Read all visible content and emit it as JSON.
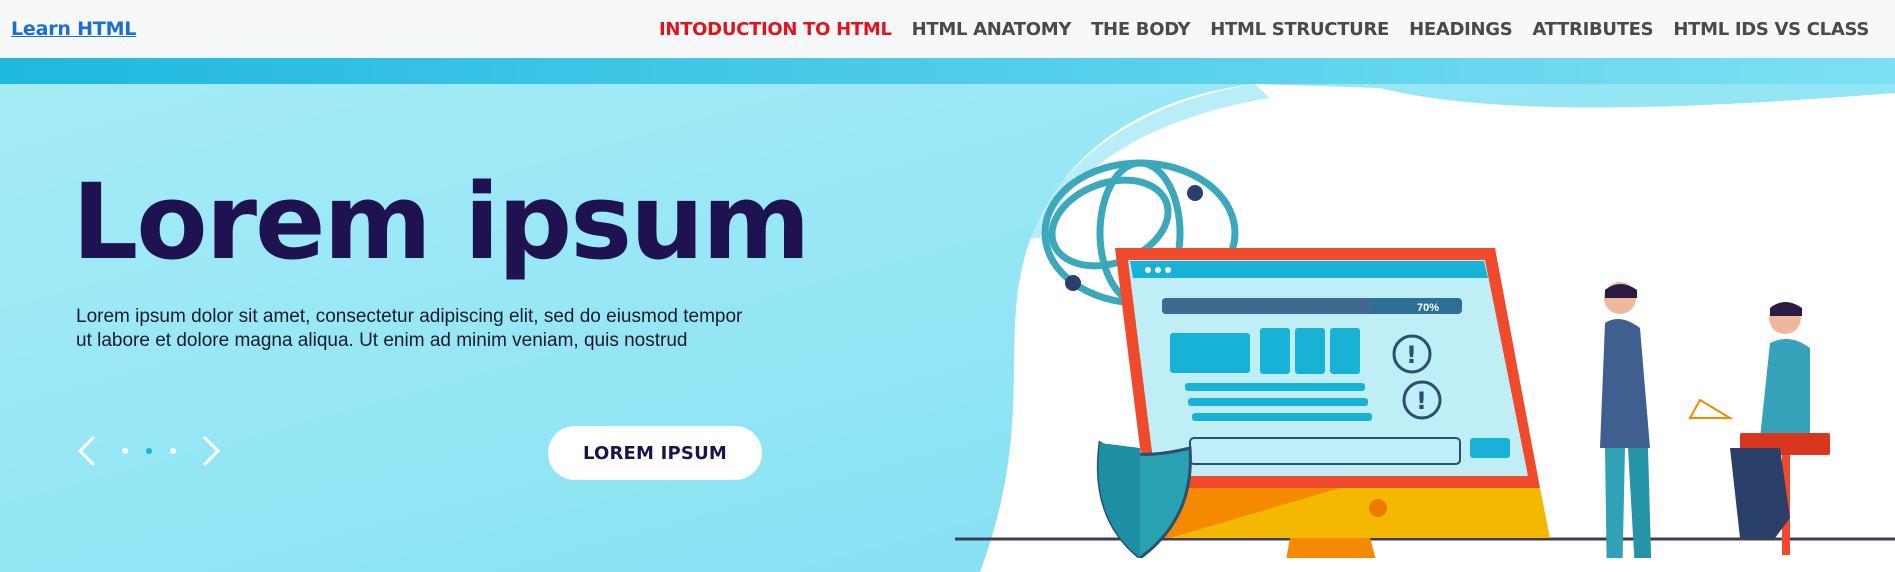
{
  "navbar": {
    "brand": "Learn HTML",
    "links": [
      {
        "label": "INTODUCTION TO HTML",
        "active": true
      },
      {
        "label": "HTML ANATOMY"
      },
      {
        "label": "THE BODY"
      },
      {
        "label": "HTML STRUCTURE"
      },
      {
        "label": "HEADINGS"
      },
      {
        "label": "ATTRIBUTES"
      },
      {
        "label": "HTML IDS VS CLASS"
      }
    ]
  },
  "hero": {
    "title": "Lorem ipsum",
    "text_line1": "Lorem ipsum dolor sit amet, consectetur adipiscing elit, sed do eiusmod tempor",
    "text_line2": "ut labore et dolore magna aliqua. Ut enim ad minim veniam, quis nostrud",
    "cta_label": "LOREM IPSUM",
    "carousel": {
      "slide_count": 3,
      "active_slide": 2
    },
    "illustration": {
      "progress_label": "70%",
      "progress_value": 0.7
    }
  },
  "colors": {
    "active_nav": "#e3131b",
    "brand_link": "#1a6fd6",
    "title": "#1e1250",
    "hero_cyan": "#8fe6f4",
    "accent_cyan": "#18b5d8",
    "monitor_frame": "#ef4a2b",
    "monitor_stand": "#f5b800"
  },
  "icons": {
    "prev": "chevron-left-icon",
    "next": "chevron-right-icon",
    "shield": "shield-icon",
    "globe": "globe-icon",
    "warning": "exclamation-icon"
  }
}
